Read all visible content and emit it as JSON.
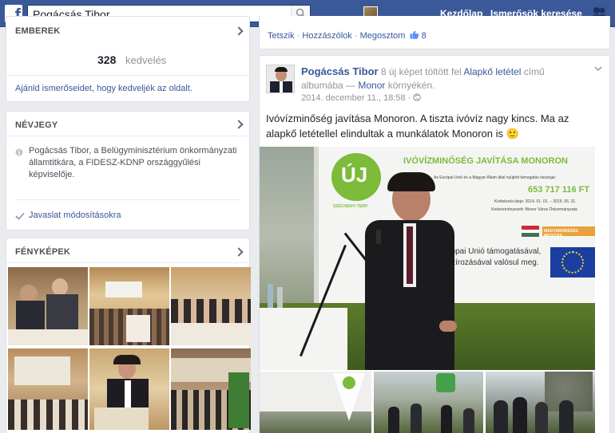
{
  "topbar": {
    "search_value": "Pogácsás Tibor",
    "nav_home": "Kezdőlap",
    "nav_find_friends": "Ismerősök keresése",
    "brand_color": "#3b5998"
  },
  "people_card": {
    "title": "EMBEREK",
    "likes_count": "328",
    "likes_word": "kedvelés",
    "invite_link": "Ajánld ismerőseidet, hogy kedveljék az oldalt."
  },
  "about_card": {
    "title": "NÉVJEGY",
    "description": "Pogácsás Tibor, a Belügyminisztérium önkormányzati államtitkára, a FIDESZ-KDNP országgyűlési képviselője.",
    "suggest_edits": "Javaslat módosításokra"
  },
  "photos_card": {
    "title": "FÉNYKÉPEK"
  },
  "previous_post": {
    "like": "Tetszik",
    "comment": "Hozzászólok",
    "share": "Megosztom",
    "like_count": "8",
    "separator": "·"
  },
  "post": {
    "author": "Pogácsás Tibor",
    "action_prefix": "8 új képet töltött fel",
    "album": "Alapkő letétel",
    "action_middle": "című albumába —",
    "place": "Monor",
    "action_suffix": "környékén.",
    "time": "2014. december 11., 18:58 ·",
    "text": "Ivóvízminőség javítása Monoron. A tiszta ivóvíz nagy kincs. Ma az alapkő letétellel elindultak a munkálatok Monoron is 🙂"
  },
  "billboard": {
    "logo": "ÚJ",
    "logo_sub": "SZÉCHENYI TERV",
    "headline": "IVÓVÍZMINŐSÉG JAVÍTÁSA MONORON",
    "support_line": "Az Európai Unió és a Magyar Állam által nyújtott támogatás összege:",
    "amount": "653 717 116 FT",
    "period": "Kivitelezés ideje: 2014. 01. 01. – 2015. 05. 31.",
    "beneficiary": "Kedvezményezett: Monor Város Önkormányzata",
    "flag_label": "MAGYARORSZÁG MEGÚJUL",
    "eu_line1": "Európai Unió támogatásával,",
    "eu_line2": "anszírozásával valósul meg."
  }
}
